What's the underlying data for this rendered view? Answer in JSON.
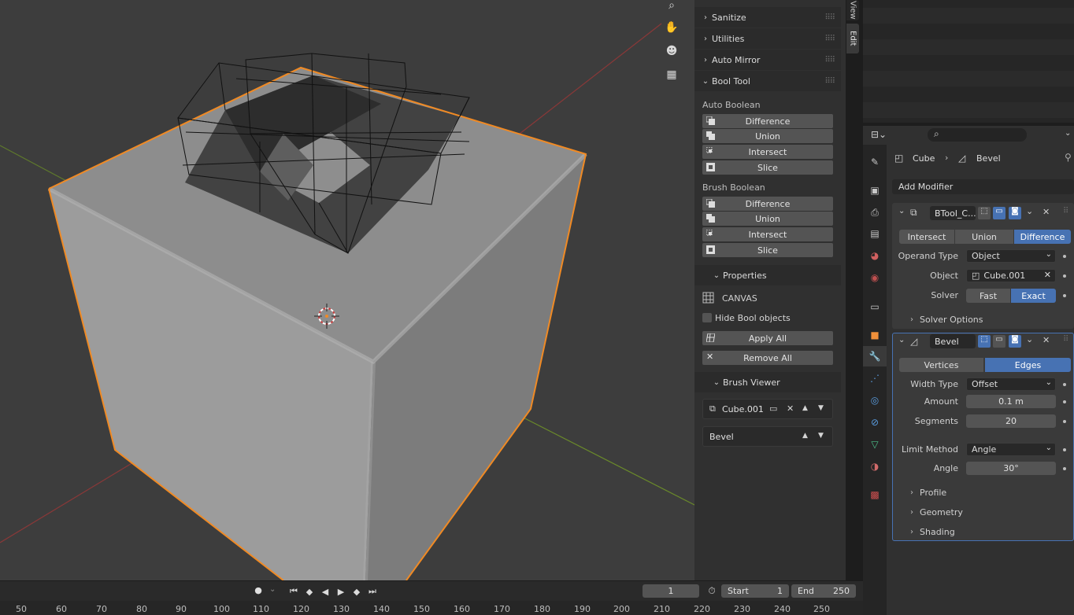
{
  "colors": {
    "accent": "#4772b3",
    "selection_outline": "#f08a24",
    "viewport_bg": "#3d3d3d"
  },
  "npanel": {
    "collapsed_sections": [
      {
        "label": "Sanitize"
      },
      {
        "label": "Utilities"
      },
      {
        "label": "Auto Mirror"
      }
    ],
    "bool_tool": {
      "title": "Bool Tool",
      "auto_boolean": {
        "heading": "Auto Boolean",
        "buttons": [
          "Difference",
          "Union",
          "Intersect",
          "Slice"
        ]
      },
      "brush_boolean": {
        "heading": "Brush Boolean",
        "buttons": [
          "Difference",
          "Union",
          "Intersect",
          "Slice"
        ]
      },
      "properties": {
        "title": "Properties",
        "canvas_label": "CANVAS",
        "hide_bool_objects": "Hide Bool objects",
        "hide_bool_checked": false,
        "apply_all": "Apply All",
        "remove_all": "Remove All"
      },
      "brush_viewer": {
        "title": "Brush Viewer",
        "brush_name": "Cube.001",
        "modifier_name": "Bevel"
      }
    }
  },
  "tabs": {
    "view": "View",
    "edit": "Edit"
  },
  "properties": {
    "breadcrumb": {
      "object": "Cube",
      "modifier": "Bevel"
    },
    "add_modifier": "Add Modifier",
    "boolean_modifier": {
      "name": "BTool_C...",
      "operations": [
        "Intersect",
        "Union",
        "Difference"
      ],
      "active_operation": "Difference",
      "operand_type_label": "Operand Type",
      "operand_type_value": "Object",
      "object_label": "Object",
      "object_value": "Cube.001",
      "solver_label": "Solver",
      "solver_options": [
        "Fast",
        "Exact"
      ],
      "active_solver": "Exact",
      "solver_options_panel": "Solver Options"
    },
    "bevel_modifier": {
      "name": "Bevel",
      "affect": [
        "Vertices",
        "Edges"
      ],
      "active_affect": "Edges",
      "width_type_label": "Width Type",
      "width_type_value": "Offset",
      "amount_label": "Amount",
      "amount_value": "0.1 m",
      "segments_label": "Segments",
      "segments_value": "20",
      "limit_method_label": "Limit Method",
      "limit_method_value": "Angle",
      "angle_label": "Angle",
      "angle_value": "30°",
      "subpanels": [
        "Profile",
        "Geometry",
        "Shading"
      ]
    }
  },
  "timeline": {
    "current_frame": "1",
    "start_label": "Start",
    "start_value": "1",
    "end_label": "End",
    "end_value": "250",
    "ticks": [
      "50",
      "60",
      "70",
      "80",
      "90",
      "100",
      "110",
      "120",
      "130",
      "140",
      "150",
      "160",
      "170",
      "180",
      "190",
      "200",
      "210",
      "220",
      "230",
      "240",
      "250"
    ]
  }
}
